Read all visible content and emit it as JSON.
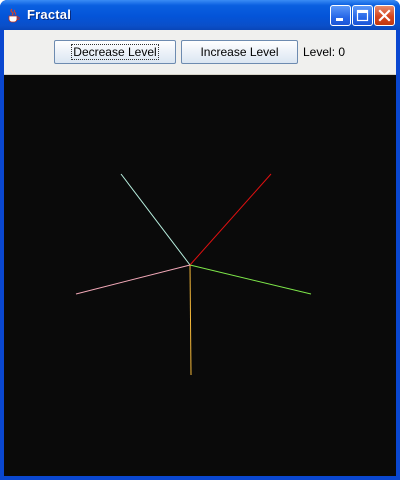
{
  "window": {
    "title": "Fractal",
    "icon": "java-cup-icon"
  },
  "toolbar": {
    "decrease_label": "Decrease Level",
    "increase_label": "Increase Level",
    "level_text": "Level: 0"
  },
  "fractal": {
    "level": 0,
    "background": "#0a0a0a",
    "branches": [
      {
        "name": "upper-left",
        "color": "#b8f0e0"
      },
      {
        "name": "upper-right",
        "color": "#e01010"
      },
      {
        "name": "right",
        "color": "#7ee84a"
      },
      {
        "name": "bottom",
        "color": "#f4b83a"
      },
      {
        "name": "left",
        "color": "#f2a8b8"
      }
    ]
  },
  "colors": {
    "titlebar": "#0454d8",
    "close_button": "#d5461f",
    "toolbar_bg": "#f0f0ee"
  }
}
